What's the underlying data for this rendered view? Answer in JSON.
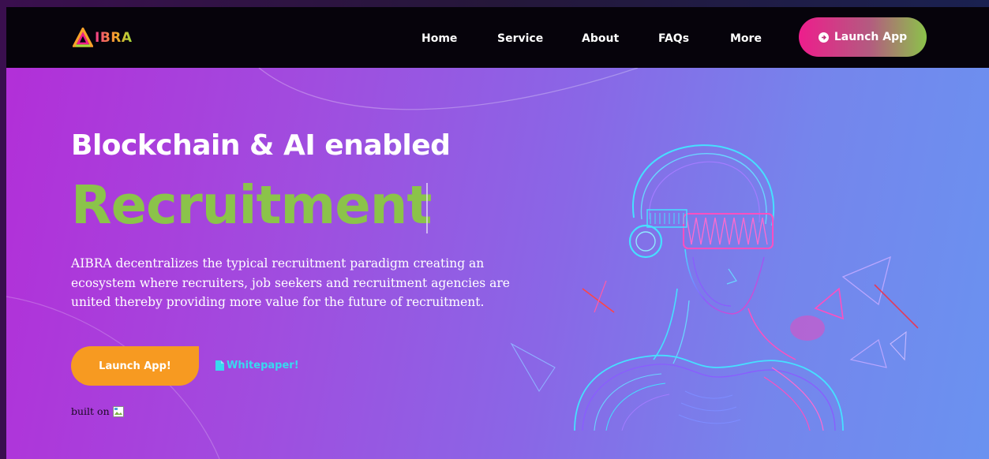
{
  "brand": {
    "name": "IBRA"
  },
  "nav": {
    "links": [
      {
        "label": "Home"
      },
      {
        "label": "Service"
      },
      {
        "label": "About"
      },
      {
        "label": "FAQs"
      },
      {
        "label": "More"
      }
    ],
    "launch_label": "Launch App"
  },
  "hero": {
    "subtitle": "Blockchain & AI enabled",
    "title": "Recruitment",
    "description": "AIBRA decentralizes the typical recruitment paradigm creating an ecosystem where recruiters, job seekers and recruitment agencies are united thereby providing more value for the future of recruitment.",
    "launch_label": "Launch App!",
    "whitepaper_label": "Whitepaper!",
    "built_on_label": "built on"
  },
  "icons": {
    "launch": "arrow-right-circle-icon",
    "whitepaper": "document-icon",
    "broken_image": "broken-image-icon"
  },
  "colors": {
    "nav_bg": "#06030b",
    "hero_start": "#b22fd8",
    "hero_end": "#6a92f0",
    "accent_green": "#8bc34a",
    "accent_orange": "#f79a21",
    "accent_cyan": "#38d9ef",
    "launch_gradient_start": "#ee1d8c"
  }
}
